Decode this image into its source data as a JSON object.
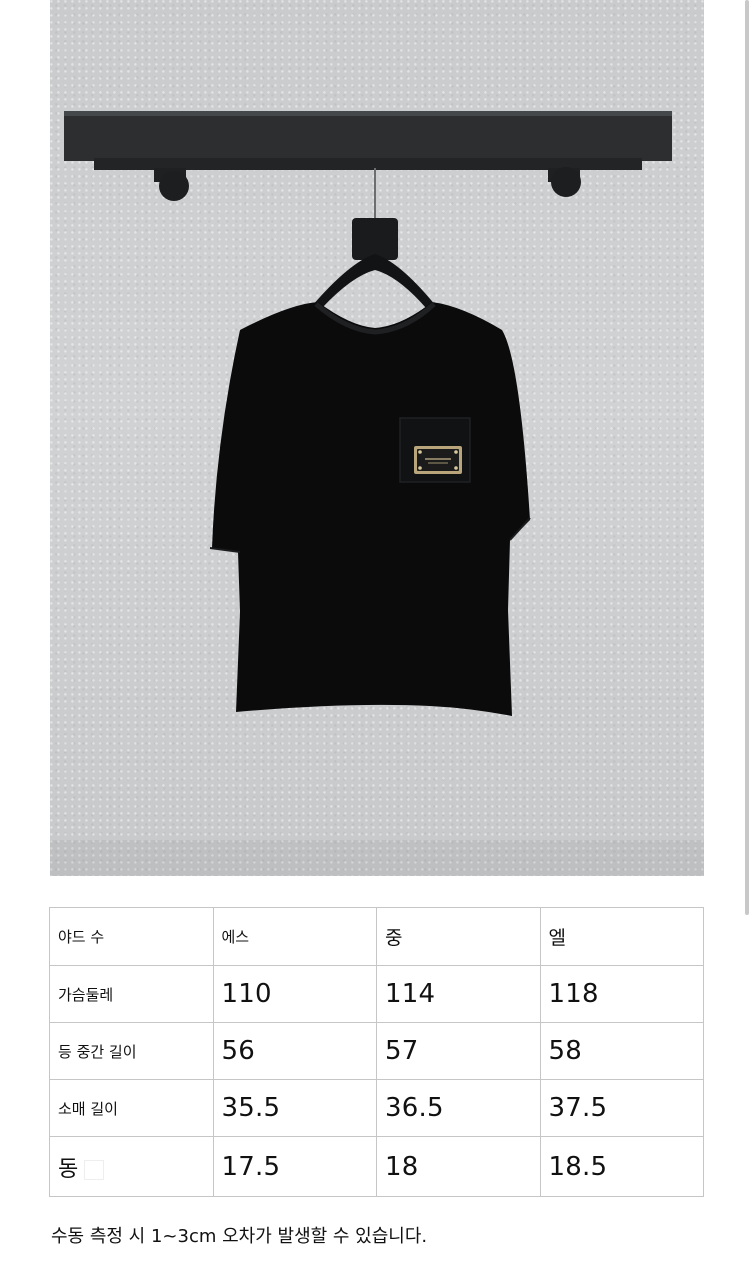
{
  "photo": {
    "alt": "black short-sleeve t-shirt on a hanger with a metal plate badge on the chest pocket"
  },
  "size_table": {
    "headers": [
      "야드 수",
      "에스",
      "중",
      "엘"
    ],
    "rows": [
      {
        "label": "가슴둘레",
        "values": [
          "110",
          "114",
          "118"
        ]
      },
      {
        "label": "등 중간 길이",
        "values": [
          "56",
          "57",
          "58"
        ]
      },
      {
        "label": "소매 길이",
        "values": [
          "35.5",
          "36.5",
          "37.5"
        ]
      },
      {
        "label": "동",
        "values": [
          "17.5",
          "18",
          "18.5"
        ]
      }
    ]
  },
  "note": "수동 측정 시 1~3cm 오차가 발생할 수 있습니다.",
  "colors": {
    "shirt": "#0b0b0c",
    "wall": "#cccfd1",
    "rack": "#2d2f31",
    "table_border": "#c6c6c6"
  }
}
